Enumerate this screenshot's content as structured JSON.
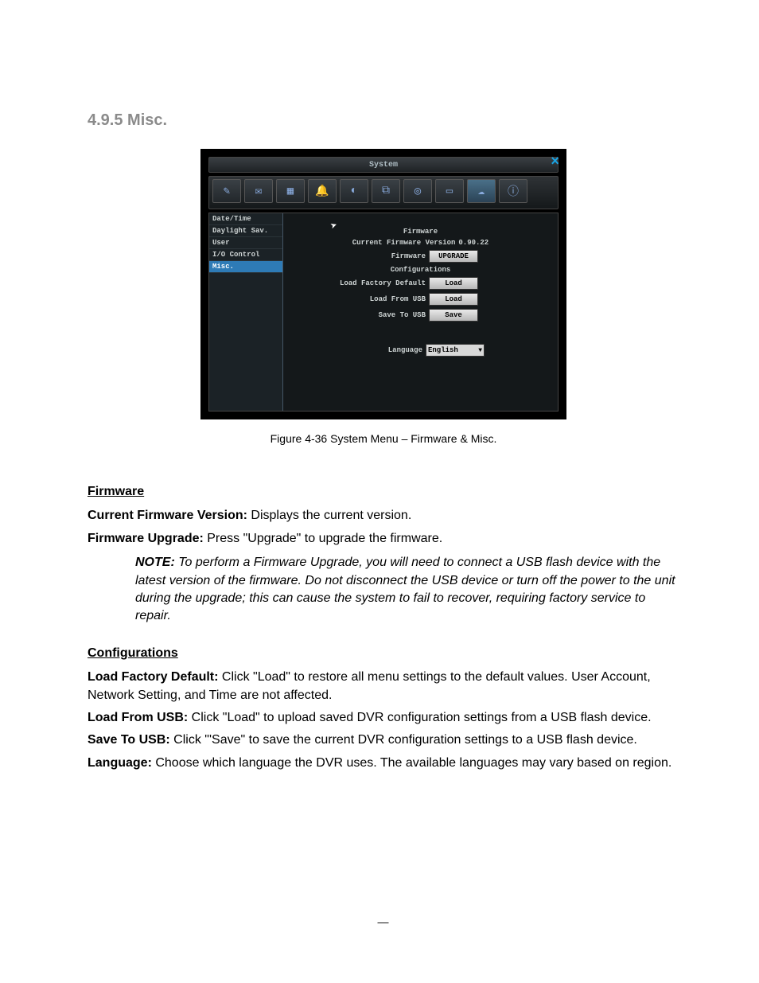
{
  "heading": "4.9.5 Misc.",
  "figure_caption": "Figure 4-36 System Menu – Firmware & Misc.",
  "window": {
    "title": "System",
    "close": "×",
    "toolbar_icons": [
      "✎",
      "✉",
      "▦",
      "🔔",
      "◐",
      "⧉",
      "◎",
      "▭",
      "☁",
      "ⓘ"
    ],
    "sidebar": [
      {
        "label": "Date/Time",
        "selected": false
      },
      {
        "label": "Daylight Sav.",
        "selected": false
      },
      {
        "label": "User",
        "selected": false
      },
      {
        "label": "I/O Control",
        "selected": false
      },
      {
        "label": "Misc.",
        "selected": true
      }
    ],
    "content": {
      "section1_title": "Firmware",
      "cfv_label": "Current Firmware Version",
      "cfv_value": "0.90.22",
      "fw_label": "Firmware",
      "fw_btn": "UPGRADE",
      "section2_title": "Configurations",
      "lfd_label": "Load Factory Default",
      "lfd_btn": "Load",
      "lfu_label": "Load From USB",
      "lfu_btn": "Load",
      "stu_label": "Save To USB",
      "stu_btn": "Save",
      "lang_label": "Language",
      "lang_value": "English"
    }
  },
  "doc": {
    "firmware_head": "Firmware",
    "cfv_label": "Current Firmware Version:",
    "cfv_text": " Displays the current version.",
    "fu_label": "Firmware Upgrade:",
    "fu_text": " Press \"Upgrade\" to upgrade the firmware.",
    "note_label": "NOTE:",
    "note_text": " To perform a Firmware Upgrade, you will need to connect a USB flash device with the latest version of the firmware. Do not disconnect the USB device or turn off the power to the unit during the upgrade; this can cause the system to fail to recover, requiring factory service to repair.",
    "config_head": "Configurations",
    "lfd_label": "Load Factory Default:",
    "lfd_text": " Click \"Load\" to restore all menu settings to the default values. User Account, Network Setting, and Time are not affected.",
    "lfu_label": "Load From USB:",
    "lfu_text": " Click \"Load\" to upload saved DVR configuration settings from a USB flash device.",
    "stu_label": "Save To USB:",
    "stu_text": " Click \"'Save\" to save the current DVR configuration settings to a USB flash device.",
    "lang_label": "Language:",
    "lang_text": " Choose which language the DVR uses. The available languages may vary based on region."
  },
  "footer": "—"
}
